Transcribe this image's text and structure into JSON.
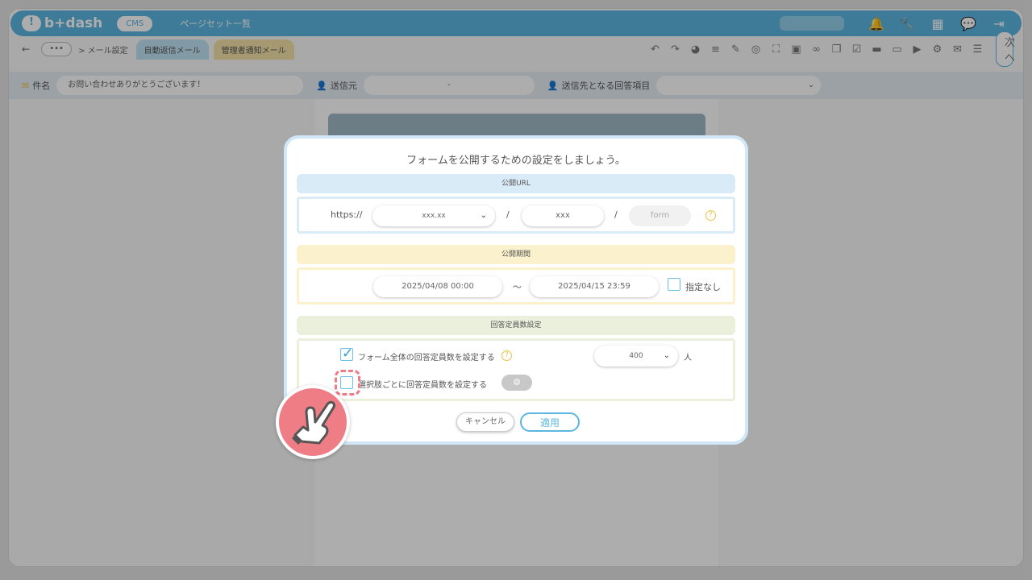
{
  "topbar": {
    "logo": "b+dash",
    "cms_label": "CMS",
    "title": "ページセット一覧"
  },
  "toolbar": {
    "breadcrumb": "> メール設定",
    "tabs": [
      {
        "label": "自動返信メール",
        "active": true
      },
      {
        "label": "管理者通知メール",
        "active": false
      }
    ],
    "next_label": "次へ"
  },
  "mailbar": {
    "subject_label": "件名",
    "subject_value": "お問い合わせありがとうございます！",
    "sender_label": "送信元",
    "sender_value": "-",
    "recipient_label": "送信先となる回答項目"
  },
  "modal": {
    "title": "フォームを公開するための設定をしましょう。",
    "url_section": {
      "heading": "公開URL",
      "prefix": "https://",
      "domain_value": "xxx.xx",
      "sep1": "/",
      "path_value": "xxx",
      "sep2": "/",
      "form_placeholder": "form"
    },
    "period_section": {
      "heading": "公開期間",
      "start": "2025/04/08 00:00",
      "tilde": "～",
      "end": "2025/04/15 23:59",
      "no_limit_label": "指定なし"
    },
    "capacity_section": {
      "heading": "回答定員数設定",
      "form_wide_label": "フォーム全体の回答定員数を設定する",
      "form_wide_checked": true,
      "capacity_value": "400",
      "unit": "人",
      "per_option_label": "選択肢ごとに回答定員数を設定する",
      "per_option_checked": false
    },
    "cancel_label": "キャンセル",
    "apply_label": "適用"
  }
}
